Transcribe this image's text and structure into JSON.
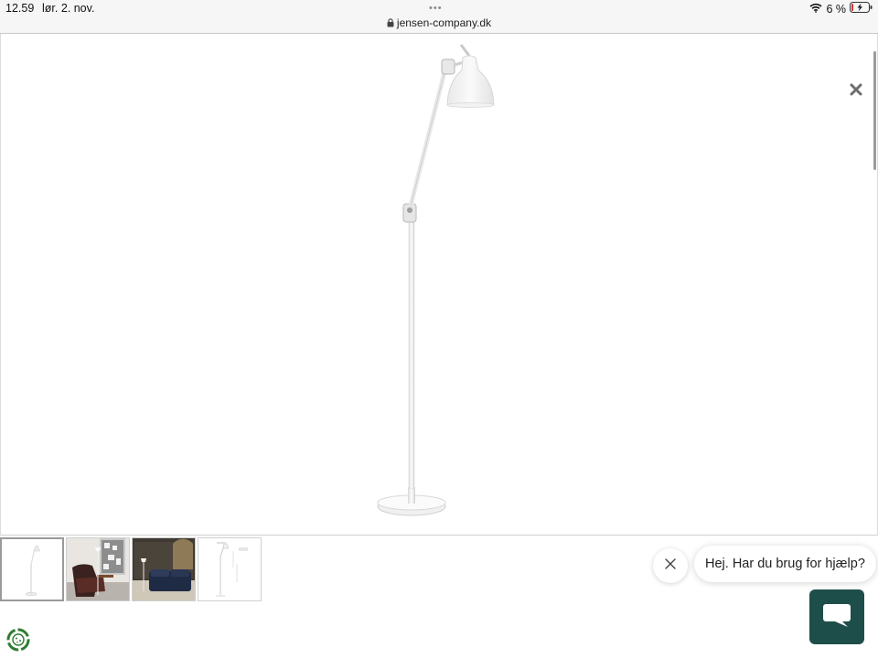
{
  "status_bar": {
    "time": "12.59",
    "date": "lør. 2. nov.",
    "menu_dots": "•••",
    "url": "jensen-company.dk",
    "battery": "6 %",
    "icons": [
      "wifi-icon",
      "battery-charging-icon",
      "lock-icon"
    ]
  },
  "viewer": {
    "product_image": "floor-lamp-white",
    "close_icon": "close-icon"
  },
  "thumbnails": [
    {
      "name": "floor-lamp-white",
      "selected": true
    },
    {
      "name": "lamp-interior-chair",
      "selected": false
    },
    {
      "name": "lamp-interior-bedroom",
      "selected": false
    },
    {
      "name": "lamp-dimension-drawing",
      "selected": false
    }
  ],
  "chat": {
    "greeting": "Hej. Har du brug for hjælp?",
    "close_icon": "close-icon",
    "launcher_icon": "chat-icon",
    "accent_color": "#1e4e4a"
  },
  "cookie_settings": {
    "icon": "cookie-icon",
    "color": "#2e7d32"
  }
}
